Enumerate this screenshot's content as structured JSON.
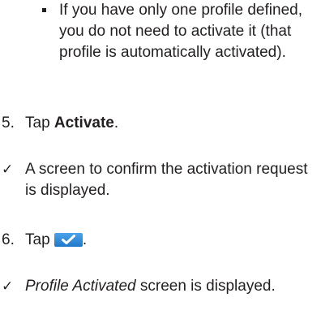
{
  "bullet": {
    "text": "If you have only one profile defined, you do not need to activate it (that profile is automatically activated)."
  },
  "steps": [
    {
      "number": "5.",
      "prefix": "Tap ",
      "bold_label": "Activate",
      "suffix": "."
    },
    {
      "number": "6.",
      "prefix": "Tap ",
      "button_icon": "checkmark-button-icon",
      "suffix": "."
    }
  ],
  "results": [
    {
      "mark": "✓",
      "text": "A screen to confirm the activation request is displayed."
    },
    {
      "mark": "✓",
      "italic_part": "Profile Activated",
      "text": " screen is displayed."
    }
  ],
  "colors": {
    "text": "#231f20",
    "button": "#2b88d8"
  }
}
